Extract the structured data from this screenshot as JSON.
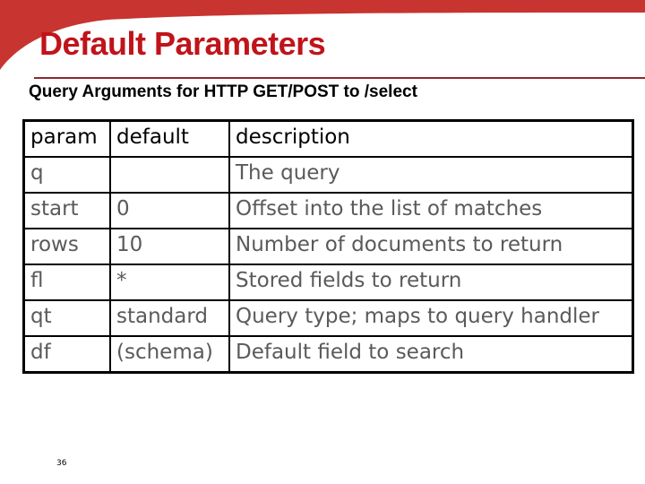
{
  "slide": {
    "title": "Default Parameters",
    "subtitle": "Query Arguments for HTTP GET/POST to /select",
    "page_number": "36",
    "accent_color": "#c0141a",
    "swoosh_color": "#c8342f"
  },
  "table": {
    "headers": [
      "param",
      "default",
      "description"
    ],
    "rows": [
      {
        "param": "q",
        "default": "",
        "description": "The query"
      },
      {
        "param": "start",
        "default": "0",
        "description": "Offset into the list of matches"
      },
      {
        "param": "rows",
        "default": "10",
        "description": "Number of documents to return"
      },
      {
        "param": "fl",
        "default": "*",
        "description": "Stored fields to return"
      },
      {
        "param": "qt",
        "default": "standard",
        "description": "Query type; maps to query handler"
      },
      {
        "param": "df",
        "default": "(schema)",
        "description": "Default field to search"
      }
    ]
  }
}
